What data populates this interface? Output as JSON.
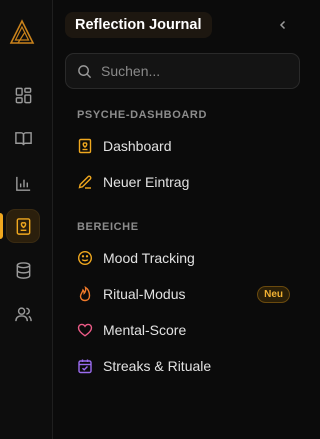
{
  "sidebar_title": "Reflection Journal",
  "search": {
    "placeholder": "Suchen..."
  },
  "sections": [
    {
      "label": "PSYCHE-DASHBOARD",
      "items": [
        {
          "label": "Dashboard",
          "icon": "journal-icon",
          "color": "#f0a81f"
        },
        {
          "label": "Neuer Eintrag",
          "icon": "pencil-icon",
          "color": "#f0a81f"
        }
      ]
    },
    {
      "label": "BEREICHE",
      "items": [
        {
          "label": "Mood Tracking",
          "icon": "smile-icon",
          "color": "#f0a81f"
        },
        {
          "label": "Ritual-Modus",
          "icon": "flame-icon",
          "color": "#f07a2a",
          "badge": "Neu"
        },
        {
          "label": "Mental-Score",
          "icon": "heart-icon",
          "color": "#ec5b87"
        },
        {
          "label": "Streaks & Rituale",
          "icon": "calendar-icon",
          "color": "#9b6cf0"
        }
      ]
    }
  ],
  "rail": [
    {
      "icon": "grid-icon",
      "active": false
    },
    {
      "icon": "book-icon",
      "active": false
    },
    {
      "icon": "bar-chart-icon",
      "active": false
    },
    {
      "icon": "journal-icon",
      "active": true
    },
    {
      "icon": "database-icon",
      "active": false
    },
    {
      "icon": "users-icon",
      "active": false
    }
  ],
  "colors": {
    "accent": "#f0a81f",
    "background": "#0b0b0b",
    "rail_background": "#0d0d0d"
  }
}
